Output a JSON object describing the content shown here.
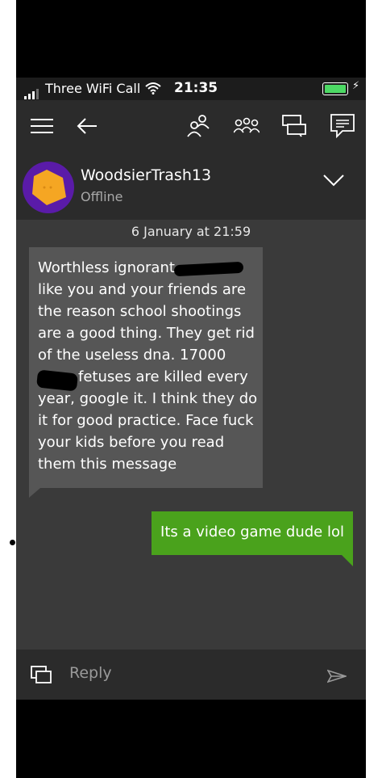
{
  "status_bar": {
    "carrier": "Three WiFi Call",
    "time": "21:35"
  },
  "toolbar": {
    "icons": [
      "menu-icon",
      "back-arrow-icon",
      "friends-icon",
      "party-icon",
      "conversations-icon",
      "compose-message-icon"
    ]
  },
  "profile": {
    "gamertag": "WoodsierTrash13",
    "presence": "Offline"
  },
  "conversation": {
    "date": "6 January at 21:59",
    "incoming_lines": [
      "Worthless ignorant",
      "like you and your friends are",
      "the reason school shootings",
      "are a good thing. They get rid",
      "of the useless dna. 17000",
      "fetuses are killed every",
      "year, google it. I think they do",
      "it for good practice. Face fuck",
      "your kids before you read",
      "them this message"
    ],
    "outgoing": "Its a video game dude lol"
  },
  "composer": {
    "placeholder": "Reply"
  },
  "colors": {
    "outgoing_bubble": "#4aa21c",
    "incoming_bubble": "#565656",
    "avatar_bg": "#5a1ba8",
    "avatar_shape": "#f5a623"
  }
}
